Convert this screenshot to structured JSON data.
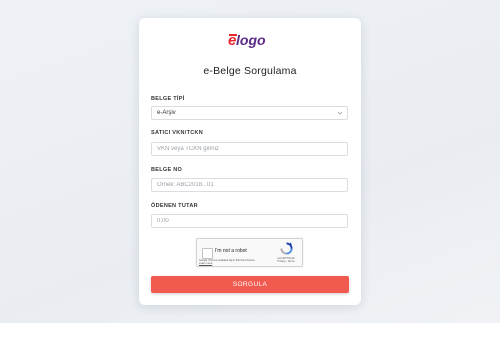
{
  "logo_text": "elogo",
  "title": "e-Belge Sorgulama",
  "fields": {
    "belge_tipi": {
      "label": "BELGE TİPİ",
      "value": "e-Arşiv"
    },
    "vkn": {
      "label": "SATICI VKN/TCKN",
      "placeholder": "VKN veya TCKN giriniz"
    },
    "belge_no": {
      "label": "BELGE NO",
      "placeholder": "Örnek: ABC2018...01"
    },
    "tutar": {
      "label": "ÖDENEN TUTAR",
      "placeholder": "0,00"
    }
  },
  "recaptcha": {
    "label": "I'm not a robot",
    "note": "Google Chrome outdated dig in first this Chrome",
    "link": "Learn more",
    "brand": "reCAPTCHA",
    "terms": "Privacy - Terms"
  },
  "submit_label": "SORGULA",
  "colors": {
    "brand_red": "#e8262a",
    "button": "#f15a4f"
  }
}
